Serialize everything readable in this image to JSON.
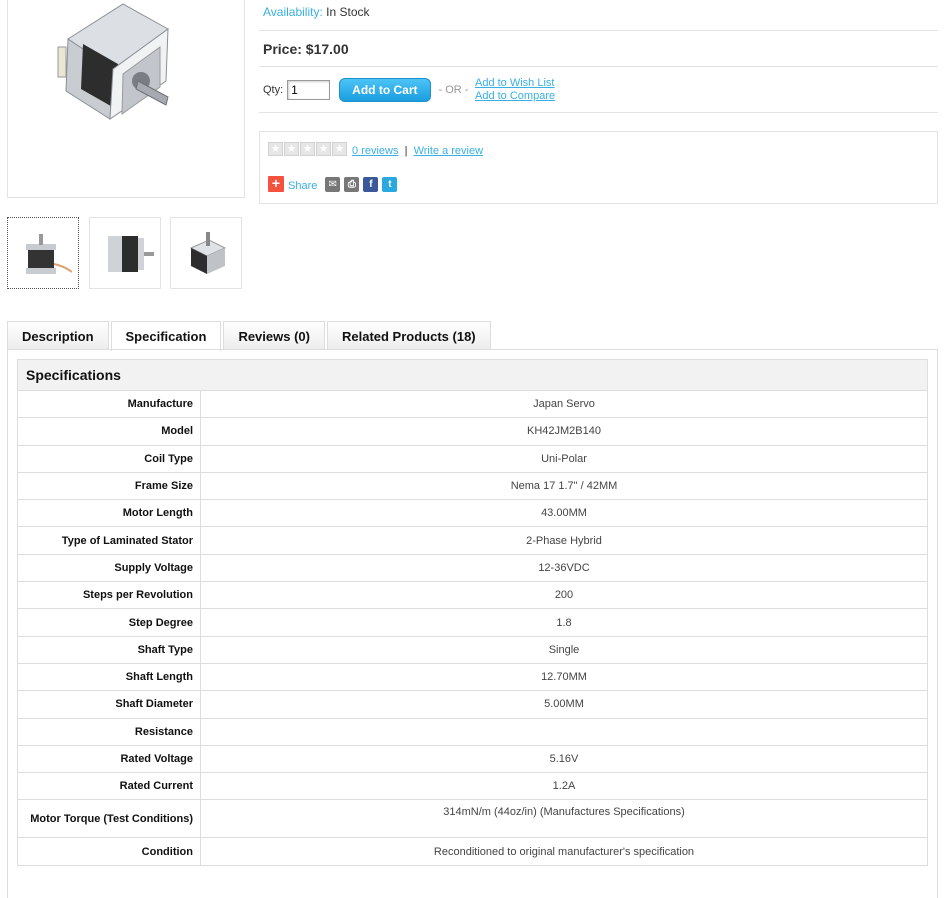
{
  "product": {
    "availability_label": "Availability:",
    "availability_value": "In Stock",
    "price": "Price: $17.00",
    "qty_label": "Qty:",
    "qty_value": "1",
    "add_to_cart": "Add to Cart",
    "or_text": "- OR -",
    "wish_list": "Add to Wish List",
    "compare": "Add to Compare"
  },
  "reviews": {
    "stars": [
      "★",
      "★",
      "★",
      "★",
      "★"
    ],
    "count_link": "0 reviews",
    "separator": "|",
    "write_link": "Write a review"
  },
  "share": {
    "plus": "+",
    "label": "Share",
    "icons": [
      {
        "name": "email-icon",
        "glyph": "✉",
        "color": "#777777"
      },
      {
        "name": "print-icon",
        "glyph": "⎙",
        "color": "#777777"
      },
      {
        "name": "facebook-icon",
        "glyph": "f",
        "color": "#3b5998"
      },
      {
        "name": "twitter-icon",
        "glyph": "t",
        "color": "#2aa9e0"
      }
    ]
  },
  "tabs": [
    {
      "label": "Description"
    },
    {
      "label": "Specification"
    },
    {
      "label": "Reviews (0)"
    },
    {
      "label": "Related Products (18)"
    }
  ],
  "spec_title": "Specifications",
  "specs": [
    {
      "key": "Manufacture",
      "value": "Japan Servo"
    },
    {
      "key": "Model",
      "value": "KH42JM2B140"
    },
    {
      "key": "Coil Type",
      "value": "Uni-Polar"
    },
    {
      "key": "Frame Size",
      "value": "Nema 17 1.7\" / 42MM"
    },
    {
      "key": "Motor Length",
      "value": "43.00MM"
    },
    {
      "key": "Type of Laminated Stator",
      "value": "2-Phase Hybrid"
    },
    {
      "key": "Supply Voltage",
      "value": "12-36VDC"
    },
    {
      "key": "Steps per Revolution",
      "value": "200"
    },
    {
      "key": "Step Degree",
      "value": "1.8"
    },
    {
      "key": "Shaft Type",
      "value": "Single"
    },
    {
      "key": "Shaft Length",
      "value": "12.70MM"
    },
    {
      "key": "Shaft Diameter",
      "value": "5.00MM"
    },
    {
      "key": "Resistance",
      "value": ""
    },
    {
      "key": "Rated Voltage",
      "value": "5.16V"
    },
    {
      "key": "Rated Current",
      "value": "1.2A"
    },
    {
      "key": "Motor Torque (Test Conditions)",
      "value": "314mN/m (44oz/in) (Manufactures Specifications)"
    },
    {
      "key": "Condition",
      "value": "Reconditioned to original manufacturer's specification"
    }
  ],
  "colors": {
    "link": "#38b0e3",
    "button": "#1a9de0"
  }
}
